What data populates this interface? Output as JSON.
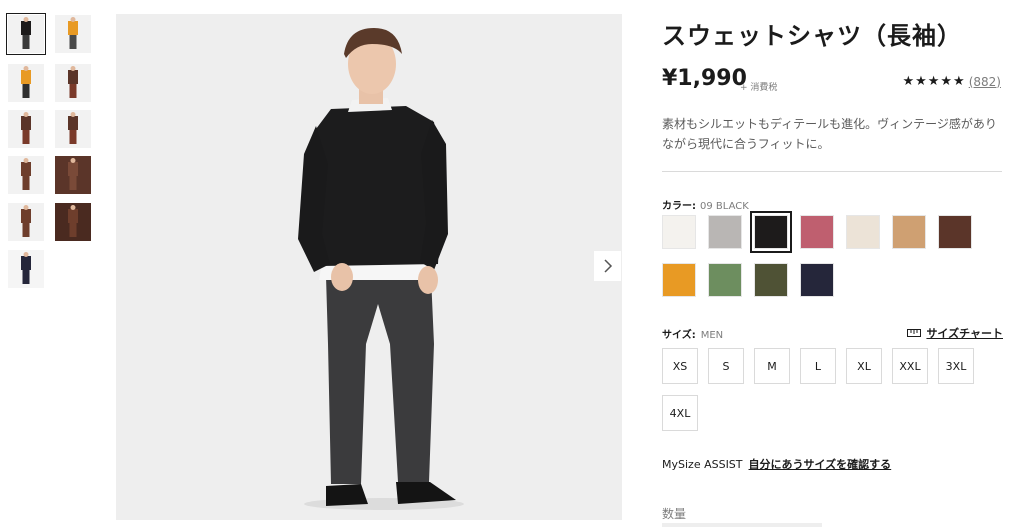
{
  "product": {
    "title": "スウェットシャツ（長袖）",
    "price": "¥1,990",
    "tax_note": "+ 消費税",
    "rating_stars": "★★★★★",
    "review_count": "(882)",
    "description": "素材もシルエットもディテールも進化。ヴィンテージ感がありながら現代に合うフィットに。"
  },
  "color": {
    "label": "カラー:",
    "selected": "09 BLACK",
    "swatches": [
      {
        "name": "off-white",
        "hex": "#f4f2ee"
      },
      {
        "name": "gray",
        "hex": "#b9b6b4"
      },
      {
        "name": "black",
        "hex": "#1d1b1b",
        "selected": true
      },
      {
        "name": "pink",
        "hex": "#bf5f6f"
      },
      {
        "name": "natural",
        "hex": "#ece3d7"
      },
      {
        "name": "beige",
        "hex": "#cfa072"
      },
      {
        "name": "brown",
        "hex": "#5b3529"
      },
      {
        "name": "orange",
        "hex": "#e89a24"
      },
      {
        "name": "green",
        "hex": "#6d8e5f"
      },
      {
        "name": "olive",
        "hex": "#4f5235"
      },
      {
        "name": "navy",
        "hex": "#25263a"
      }
    ]
  },
  "size": {
    "label": "サイズ:",
    "category": "MEN",
    "chart_link": "サイズチャート",
    "options": [
      "XS",
      "S",
      "M",
      "L",
      "XL",
      "XXL",
      "3XL",
      "4XL"
    ]
  },
  "mysize": {
    "label": "MySize ASSIST",
    "link": "自分にあうサイズを確認する"
  },
  "quantity": {
    "label": "数量"
  },
  "thumbnails": [
    {
      "name": "black-front",
      "bg": "#f2f2f2",
      "top": "#1d1b1b",
      "bottom": "#3a3a3a",
      "selected": true
    },
    {
      "name": "orange-front",
      "bg": "#f2f2f2",
      "top": "#e89a24",
      "bottom": "#4a4a4a"
    },
    {
      "name": "orange-model",
      "bg": "#f2f2f2",
      "top": "#e89a24",
      "bottom": "#2f2f2f"
    },
    {
      "name": "brown-model",
      "bg": "#f2f2f2",
      "top": "#5b3529",
      "bottom": "#7a3a2a"
    },
    {
      "name": "brown-model-2",
      "bg": "#f2f2f2",
      "top": "#5b3529",
      "bottom": "#7a3a2a"
    },
    {
      "name": "brown-model-3",
      "bg": "#f2f2f2",
      "top": "#5b3529",
      "bottom": "#7a3a2a"
    },
    {
      "name": "brown-closeup",
      "bg": "#f2f2f2",
      "top": "#6e3e2c",
      "bottom": "#6e3e2c"
    },
    {
      "name": "brown-sleeve",
      "bg": "#5b3529",
      "top": "#7a4a38",
      "bottom": "#7a4a38"
    },
    {
      "name": "brown-flat",
      "bg": "#f2f2f2",
      "top": "#6e3e2c",
      "bottom": "#6e3e2c"
    },
    {
      "name": "brown-fabric",
      "bg": "#4a2a20",
      "top": "#6e3e2c",
      "bottom": "#6e3e2c"
    },
    {
      "name": "navy-detail",
      "bg": "#f5f5f5",
      "top": "#25263a",
      "bottom": "#25263a"
    }
  ]
}
